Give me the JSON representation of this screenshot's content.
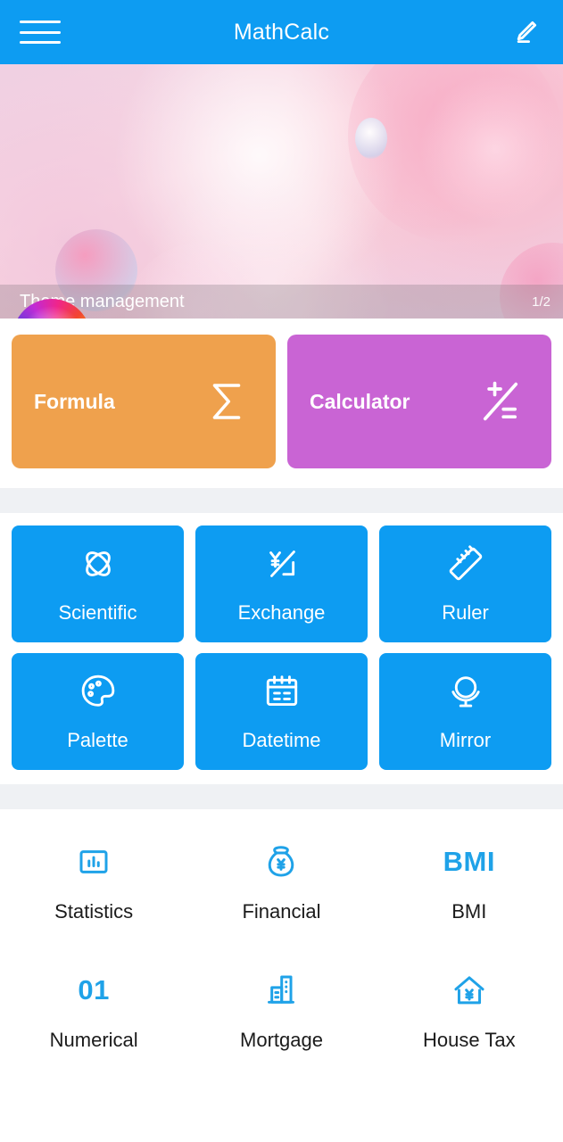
{
  "header": {
    "title": "MathCalc",
    "menu_icon": "hamburger-menu-icon",
    "edit_icon": "pencil-edit-icon"
  },
  "banner": {
    "label": "Theme management",
    "page_indicator": "1/2",
    "wheel_icon": "color-wheel-icon"
  },
  "feature_cards": [
    {
      "label": "Formula",
      "icon": "sigma-icon",
      "color": "#efa14d"
    },
    {
      "label": "Calculator",
      "icon": "plus-minus-equals-icon",
      "color": "#c964d4"
    }
  ],
  "tiles": [
    {
      "label": "Scientific",
      "icon": "atom-icon"
    },
    {
      "label": "Exchange",
      "icon": "currency-exchange-icon"
    },
    {
      "label": "Ruler",
      "icon": "ruler-icon"
    },
    {
      "label": "Palette",
      "icon": "paint-palette-icon"
    },
    {
      "label": "Datetime",
      "icon": "calendar-icon"
    },
    {
      "label": "Mirror",
      "icon": "vanity-mirror-icon"
    }
  ],
  "icon_items": [
    {
      "label": "Statistics",
      "icon": "bar-chart-icon",
      "text": ""
    },
    {
      "label": "Financial",
      "icon": "money-bag-icon",
      "text": ""
    },
    {
      "label": "BMI",
      "icon": "bmi-text-icon",
      "text": "BMI"
    },
    {
      "label": "Numerical",
      "icon": "zero-one-text-icon",
      "text": "01"
    },
    {
      "label": "Mortgage",
      "icon": "building-icon",
      "text": ""
    },
    {
      "label": "House Tax",
      "icon": "house-yen-icon",
      "text": ""
    }
  ],
  "colors": {
    "primary": "#0d9cf2",
    "icon_blue": "#1fa2e8",
    "formula_card": "#efa14d",
    "calculator_card": "#c964d4",
    "separator": "#eff1f4"
  }
}
